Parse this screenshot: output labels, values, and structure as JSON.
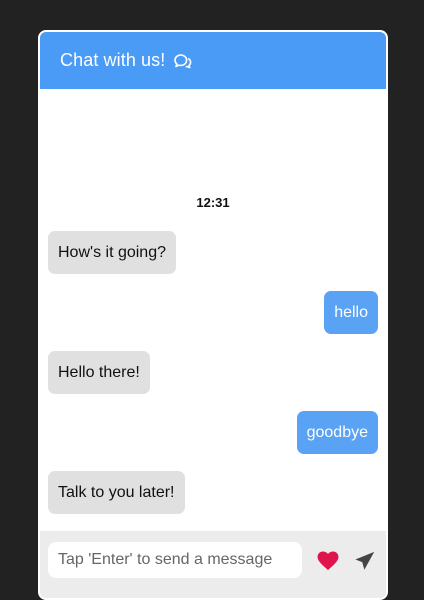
{
  "header": {
    "title": "Chat with us!",
    "icon": "chat-bubbles-icon",
    "background": "#4a9bf5"
  },
  "conversation": {
    "timestamp": "12:31",
    "messages": [
      {
        "sender": "bot",
        "text": "How's it going?"
      },
      {
        "sender": "user",
        "text": "hello"
      },
      {
        "sender": "bot",
        "text": "Hello there!"
      },
      {
        "sender": "user",
        "text": "goodbye"
      },
      {
        "sender": "bot",
        "text": "Talk to you later!"
      }
    ]
  },
  "composer": {
    "placeholder": "Tap 'Enter' to send a message",
    "value": "",
    "like_icon": "heart-icon",
    "like_color": "#e0144c",
    "send_icon": "send-icon",
    "send_color": "#444444"
  },
  "colors": {
    "incoming_bubble": "#e0e0e0",
    "outgoing_bubble": "#5aa2f3",
    "page_background": "#222222"
  }
}
